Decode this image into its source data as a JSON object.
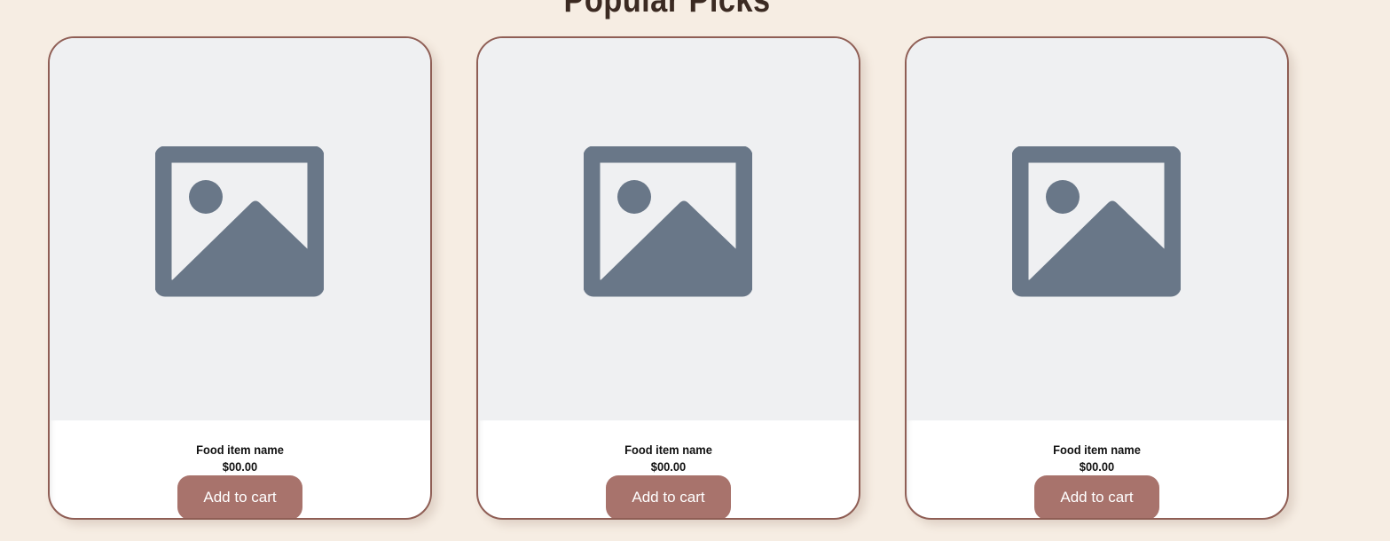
{
  "section": {
    "title": "Popular Picks"
  },
  "colors": {
    "background": "#f6ede3",
    "card_border": "#8f5e55",
    "button": "#a8736c",
    "placeholder_bg": "#eff0f2",
    "placeholder_icon": "#697788"
  },
  "cards": [
    {
      "name": "Food item name",
      "price": "$00.00",
      "button_label": "Add to cart",
      "image_icon": "image-placeholder-icon"
    },
    {
      "name": "Food item name",
      "price": "$00.00",
      "button_label": "Add to cart",
      "image_icon": "image-placeholder-icon"
    },
    {
      "name": "Food item name",
      "price": "$00.00",
      "button_label": "Add to cart",
      "image_icon": "image-placeholder-icon"
    }
  ]
}
